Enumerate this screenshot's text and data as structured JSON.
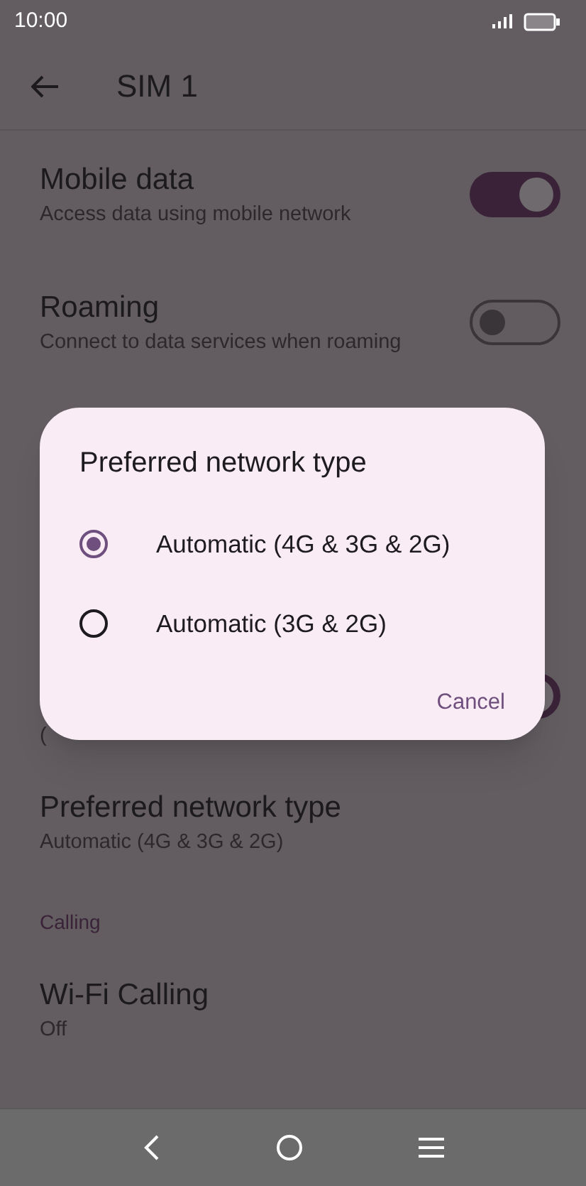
{
  "status_bar": {
    "time": "10:00"
  },
  "app_bar": {
    "title": "SIM 1"
  },
  "settings": [
    {
      "kind": "switch",
      "title": "Mobile data",
      "subtitle": "Access data using mobile network",
      "on": true
    },
    {
      "kind": "switch",
      "title": "Roaming",
      "subtitle": "Connect to data services when roaming",
      "on": false
    },
    {
      "kind": "partial",
      "subtitle": "(",
      "on": true
    },
    {
      "kind": "item",
      "title": "Preferred network type",
      "subtitle": "Automatic (4G & 3G & 2G)"
    },
    {
      "kind": "header",
      "title": "Calling"
    },
    {
      "kind": "item",
      "title": "Wi-Fi Calling",
      "subtitle": "Off"
    }
  ],
  "dialog": {
    "title": "Preferred network type",
    "options": [
      {
        "label": "Automatic (4G & 3G & 2G)",
        "selected": true
      },
      {
        "label": "Automatic (3G & 2G)",
        "selected": false
      }
    ],
    "buttons": [
      "Cancel"
    ]
  }
}
